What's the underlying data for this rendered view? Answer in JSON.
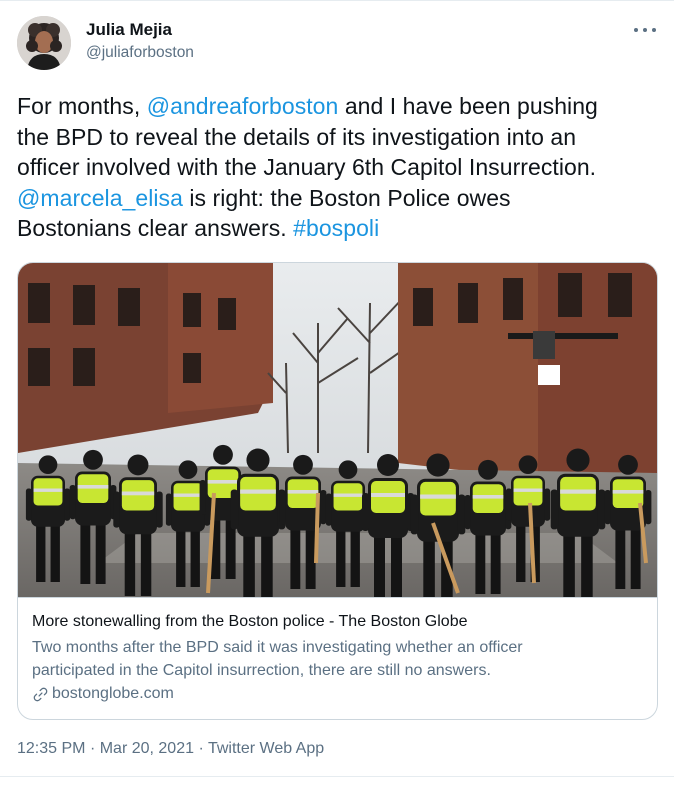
{
  "author": {
    "name": "Julia Mejia",
    "handle": "@juliaforboston",
    "avatar_icon": "profile-photo"
  },
  "tweet": {
    "segments": [
      [
        {
          "text": "For months, ",
          "link": false
        },
        {
          "text": "@andreaforboston",
          "link": true
        },
        {
          "text": " and I have been pushing",
          "link": false
        }
      ],
      [
        {
          "text": "the BPD to reveal the details of its investigation into an",
          "link": false
        }
      ],
      [
        {
          "text": "officer involved with the January 6th Capitol Insurrection.",
          "link": false
        }
      ],
      [
        {
          "text": "@marcela_elisa",
          "link": true
        },
        {
          "text": " is right: the Boston Police owes",
          "link": false
        }
      ],
      [
        {
          "text": "Bostonians clear answers. ",
          "link": false
        },
        {
          "text": "#bospoli",
          "link": true
        }
      ]
    ]
  },
  "card": {
    "title": "More stonewalling from the Boston police - The Boston Globe",
    "description_lines": [
      "Two months after the BPD said it was investigating whether an officer",
      "participated in the Capitol insurrection, there are still no answers."
    ],
    "domain": "bostonglobe.com",
    "domain_icon": "link-icon"
  },
  "meta": {
    "time": "12:35 PM",
    "separator": "·",
    "date": "Mar 20, 2021",
    "source": "Twitter Web App"
  },
  "colors": {
    "link": "#1b95e0",
    "secondary_text": "#5b7083",
    "border": "#ccd6dd",
    "vest": "#c8e632"
  }
}
